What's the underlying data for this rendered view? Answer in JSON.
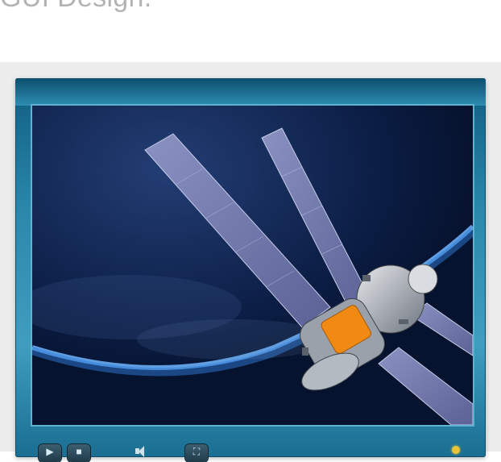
{
  "page": {
    "heading": "GUI Design."
  },
  "player": {
    "video_description_icon": "satellite-orbit-image",
    "controls": {
      "play_icon": "play-icon",
      "stop_icon": "stop-icon",
      "volume_icon": "volume-icon",
      "fullscreen_icon": "fullscreen-icon",
      "status_icon": "status-dot-icon"
    }
  },
  "colors": {
    "frame": "#2a88ab",
    "screen": "#020a1d",
    "status": "#e7c43a"
  }
}
